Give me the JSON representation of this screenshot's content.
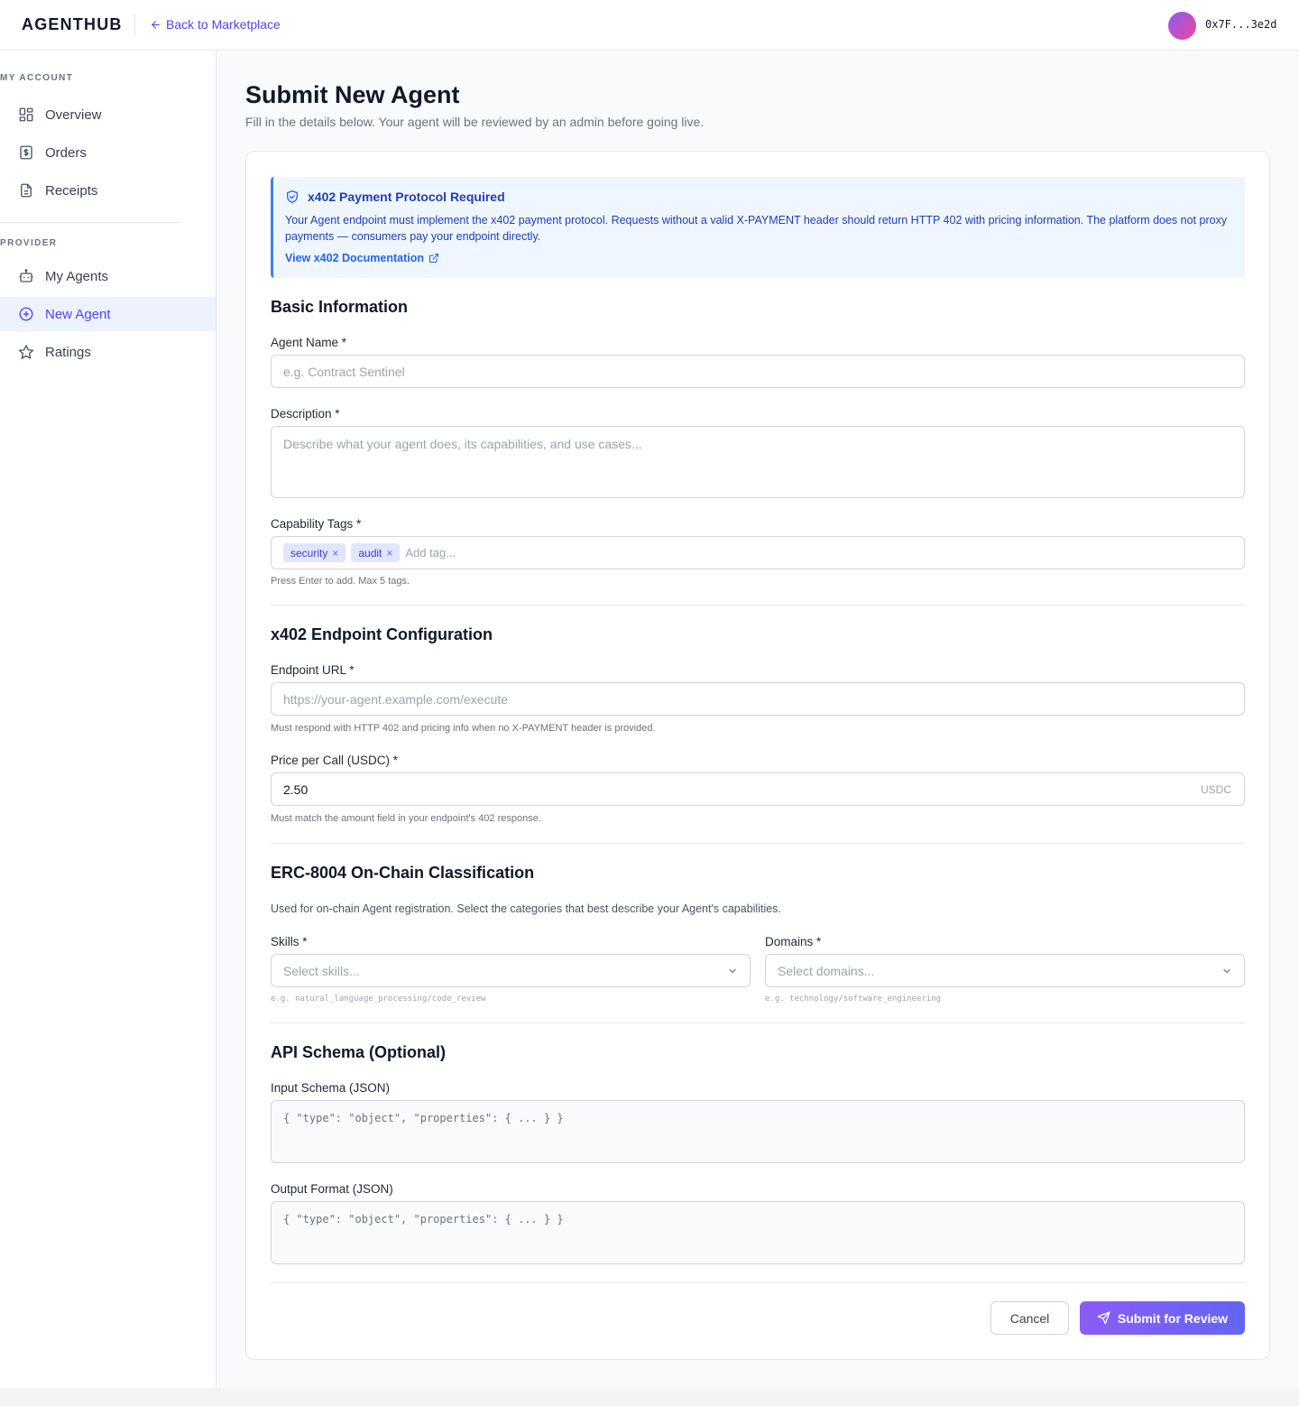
{
  "header": {
    "logo": "AGENTHUB",
    "back_link": "Back to Marketplace",
    "wallet": "0x7F...3e2d"
  },
  "sidebar": {
    "my_account_label": "MY ACCOUNT",
    "my_account_items": [
      {
        "label": "Overview",
        "icon": "grid-icon"
      },
      {
        "label": "Orders",
        "icon": "dollar-doc-icon"
      },
      {
        "label": "Receipts",
        "icon": "document-icon"
      }
    ],
    "provider_label": "PROVIDER",
    "provider_items": [
      {
        "label": "My Agents",
        "icon": "robot-icon"
      },
      {
        "label": "New Agent",
        "icon": "plus-circle-icon",
        "active": true
      },
      {
        "label": "Ratings",
        "icon": "star-icon"
      }
    ]
  },
  "page": {
    "title": "Submit New Agent",
    "subtitle": "Fill in the details below. Your agent will be reviewed by an admin before going live."
  },
  "notice": {
    "title": "x402 Payment Protocol Required",
    "body": "Your Agent endpoint must implement the x402 payment protocol. Requests without a valid X-PAYMENT header should return HTTP 402 with pricing information. The platform does not proxy payments — consumers pay your endpoint directly.",
    "link": "View x402 Documentation"
  },
  "basic": {
    "section_title": "Basic Information",
    "name_label": "Agent Name *",
    "name_placeholder": "e.g. Contract Sentinel",
    "desc_label": "Description *",
    "desc_placeholder": "Describe what your agent does, its capabilities, and use cases...",
    "tags_label": "Capability Tags *",
    "tags": [
      "security",
      "audit"
    ],
    "tag_remove": "×",
    "tag_placeholder": "Add tag...",
    "tags_hint": "Press Enter to add. Max 5 tags."
  },
  "endpoint": {
    "section_title": "x402 Endpoint Configuration",
    "url_label": "Endpoint URL *",
    "url_placeholder": "https://your-agent.example.com/execute",
    "url_hint": "Must respond with HTTP 402 and pricing info when no X-PAYMENT header is provided.",
    "price_label": "Price per Call (USDC) *",
    "price_value": "2.50",
    "price_suffix": "USDC",
    "price_hint": "Must match the amount field in your endpoint's 402 response."
  },
  "erc": {
    "section_title": "ERC-8004 On-Chain Classification",
    "description": "Used for on-chain Agent registration. Select the categories that best describe your Agent's capabilities.",
    "skills_label": "Skills *",
    "skills_placeholder": "Select skills...",
    "skills_hint": "e.g. natural_language_processing/code_review",
    "domains_label": "Domains *",
    "domains_placeholder": "Select domains...",
    "domains_hint": "e.g. technology/software_engineering"
  },
  "schema": {
    "section_title": "API Schema (Optional)",
    "input_label": "Input Schema (JSON)",
    "input_placeholder": "{ \"type\": \"object\", \"properties\": { ... } }",
    "output_label": "Output Format (JSON)",
    "output_placeholder": "{ \"type\": \"object\", \"properties\": { ... } }"
  },
  "actions": {
    "cancel": "Cancel",
    "submit": "Submit for Review"
  },
  "colors": {
    "accent": "#4f46e5",
    "notice_bg": "#eff6ff",
    "notice_border": "#3b82f6",
    "submit_gradient_start": "#8b5cf6",
    "submit_gradient_end": "#6366f1"
  }
}
